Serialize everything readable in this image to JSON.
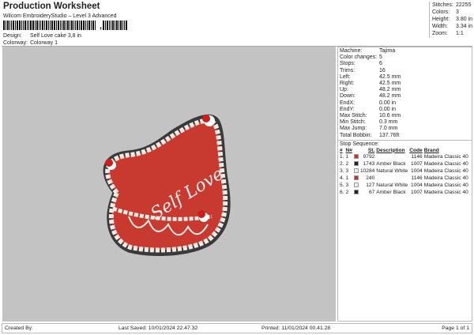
{
  "header": {
    "title": "Production Worksheet",
    "software": "Wilcom EmbroideryStudio – Level 3 Advanced",
    "barcode_suffix": ",",
    "design_label": "Design:",
    "design": "Self Love cake 3,8 in",
    "colorway_label": "Colorway:",
    "colorway": "Colorway 1"
  },
  "stats": [
    {
      "k": "Stitches:",
      "v": "22255"
    },
    {
      "k": "Colors:",
      "v": "3"
    },
    {
      "k": "Height:",
      "v": "3.80 in"
    },
    {
      "k": "Width:",
      "v": "3.34 in"
    },
    {
      "k": "Zoom:",
      "v": "1:1"
    }
  ],
  "design_text": "Self Love",
  "details": [
    {
      "k": "Machine:",
      "v": "Tajima"
    },
    {
      "k": "Color changes:",
      "v": "5"
    },
    {
      "k": "Stops:",
      "v": "6"
    },
    {
      "k": "Trims:",
      "v": "16"
    },
    {
      "k": "Left:",
      "v": "42.5 mm"
    },
    {
      "k": "Right:",
      "v": "42.5 mm"
    },
    {
      "k": "Up:",
      "v": "48.2 mm"
    },
    {
      "k": "Down:",
      "v": "48.2 mm"
    },
    {
      "k": "EndX:",
      "v": "0.00 in"
    },
    {
      "k": "EndY:",
      "v": "0.00 in"
    },
    {
      "k": "Max Stitch:",
      "v": "10.6 mm"
    },
    {
      "k": "Min Stitch:",
      "v": "0.3 mm"
    },
    {
      "k": "Max Jump:",
      "v": "7.0 mm"
    },
    {
      "k": "Total Bobbin:",
      "v": "137.76ft"
    }
  ],
  "stop_sequence": {
    "title": "Stop Sequence:",
    "headers": [
      "#",
      "N#",
      "St.",
      "Description",
      "Code",
      "Brand"
    ],
    "rows": [
      {
        "n": "1.",
        "nn": "1",
        "color": "#d42a2a",
        "st": "9792",
        "desc": "",
        "code": "1146",
        "brand": "Madeira Classic 40"
      },
      {
        "n": "2.",
        "nn": "2",
        "color": "#222222",
        "st": "1743",
        "desc": "Amber Black",
        "code": "1007",
        "brand": "Madeira Classic 40"
      },
      {
        "n": "3.",
        "nn": "3",
        "color": "#eeeeee",
        "st": "10284",
        "desc": "Natural White",
        "code": "1004",
        "brand": "Madeira Classic 40"
      },
      {
        "n": "4.",
        "nn": "1",
        "color": "#d42a2a",
        "st": "240",
        "desc": "",
        "code": "1146",
        "brand": "Madeira Classic 40"
      },
      {
        "n": "5.",
        "nn": "3",
        "color": "#eeeeee",
        "st": "127",
        "desc": "Natural White",
        "code": "1004",
        "brand": "Madeira Classic 40"
      },
      {
        "n": "6.",
        "nn": "2",
        "color": "#222222",
        "st": "67",
        "desc": "Amber Black",
        "code": "1007",
        "brand": "Madeira Classic 40"
      }
    ]
  },
  "footer": {
    "created": "Created By:",
    "saved": "Last Saved: 10/01/2024 22.47.32",
    "printed": "Printed: 11/01/2024 00.41.28",
    "page": "Page 1 of 1"
  }
}
